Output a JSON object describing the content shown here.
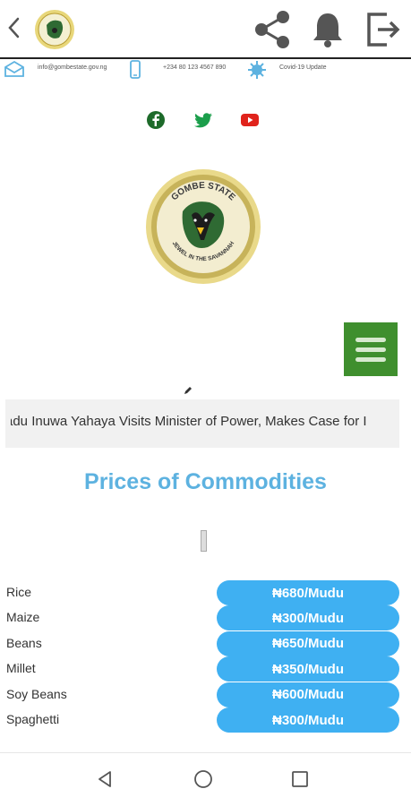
{
  "header": {
    "back_icon": "chevron-left-icon",
    "logo_icon": "gombe-state-seal-icon",
    "share_icon": "share-icon",
    "bell_icon": "bell-icon",
    "logout_icon": "logout-icon"
  },
  "contact": {
    "email": "info@gombestate.gov.ng",
    "phone": "+234 80 123 4567 890",
    "covid": "Covid-19 Update"
  },
  "social": [
    "facebook-icon",
    "twitter-icon",
    "youtube-icon"
  ],
  "seal": {
    "top_text": "GOMBE STATE",
    "bottom_text": "JEWEL IN THE SAVANNAH"
  },
  "ticker": {
    "text": "adu Inuwa Yahaya Visits Minister of Power, Makes Case for I"
  },
  "prices": {
    "title": "Prices of Commodities",
    "items": [
      {
        "name": "Rice",
        "price": "₦680/Mudu"
      },
      {
        "name": "Maize",
        "price": "₦300/Mudu"
      },
      {
        "name": "Beans",
        "price": "₦650/Mudu"
      },
      {
        "name": "Millet",
        "price": "₦350/Mudu"
      },
      {
        "name": "Soy Beans",
        "price": "₦600/Mudu"
      },
      {
        "name": "Spaghetti",
        "price": "₦300/Mudu"
      }
    ]
  },
  "colors": {
    "accent_green": "#3f8f2e",
    "title_blue": "#5db2e0",
    "pill_blue": "#3fb0f2"
  },
  "navbar": [
    "back-triangle-icon",
    "home-circle-icon",
    "recents-square-icon"
  ]
}
